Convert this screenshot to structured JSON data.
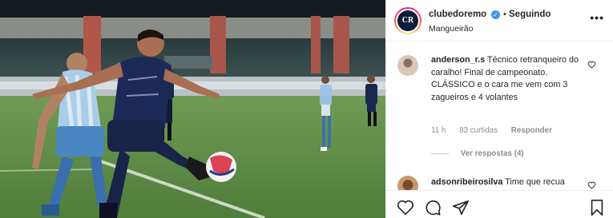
{
  "post": {
    "username": "clubedoremo",
    "verified_icon": "verified-badge-icon",
    "follow_separator": "•",
    "follow_status": "Seguindo",
    "location": "Mangueirão",
    "more_icon": "more-options-icon",
    "more_text": "•••",
    "avatar_text": "CR"
  },
  "comments": [
    {
      "username": "anderson_r.s",
      "text": "Técnico retranqueiro do caralho! Final de campeonato. CLÁSSICO e o cara me vem com 3 zagueiros e 4 volantes",
      "time": "11 h",
      "likes": "83 curtidas",
      "reply_label": "Responder",
      "view_replies": "Ver respostas (4)"
    },
    {
      "username": "adsonribeirosilva",
      "text": "Time que recua"
    }
  ],
  "actions": {
    "like_icon": "heart-icon",
    "comment_icon": "comment-icon",
    "share_icon": "share-icon",
    "save_icon": "bookmark-icon"
  },
  "colors": {
    "text": "#262626",
    "muted": "#8e8e8e",
    "verified": "#3897f0",
    "border": "#efefef"
  }
}
